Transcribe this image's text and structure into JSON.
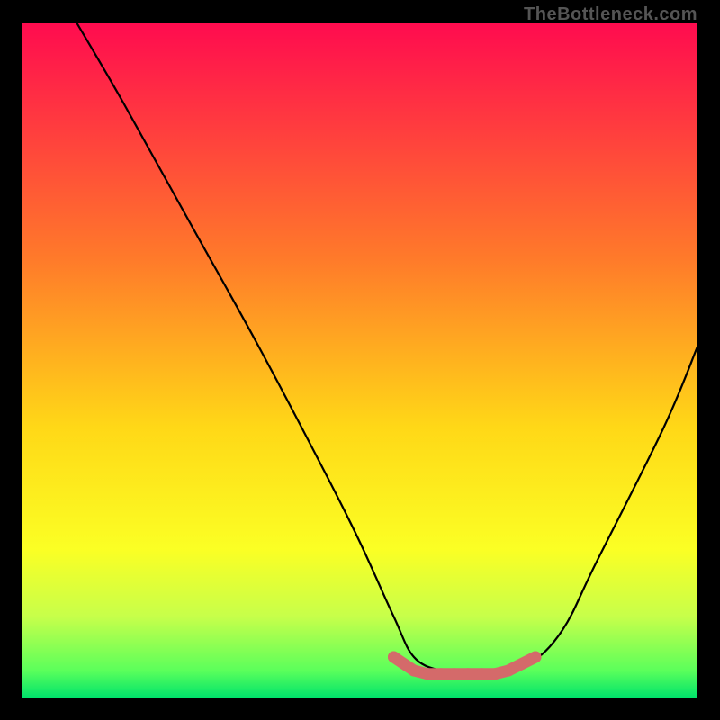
{
  "watermark": "TheBottleneck.com",
  "chart_data": {
    "type": "line",
    "title": "",
    "xlabel": "",
    "ylabel": "",
    "xlim": [
      0,
      100
    ],
    "ylim": [
      0,
      100
    ],
    "series": [
      {
        "name": "bottleneck-curve",
        "x": [
          8,
          15,
          25,
          35,
          45,
          50,
          55,
          58,
          62,
          65,
          70,
          75,
          80,
          85,
          95,
          100
        ],
        "y": [
          100,
          88,
          70,
          52,
          33,
          23,
          12,
          6,
          4,
          4,
          4,
          5,
          10,
          20,
          40,
          52
        ]
      }
    ],
    "bottom_points": {
      "name": "optimal-range-markers",
      "x": [
        55,
        58,
        60,
        62,
        64,
        66,
        68,
        70,
        72,
        74,
        76
      ],
      "y": [
        6,
        4,
        3.5,
        3.5,
        3.5,
        3.5,
        3.5,
        3.5,
        4,
        5,
        6
      ],
      "color": "#d46a6a"
    },
    "background_gradient": {
      "stops": [
        {
          "offset": 0.0,
          "color": "#ff0b4f"
        },
        {
          "offset": 0.35,
          "color": "#ff7a2a"
        },
        {
          "offset": 0.6,
          "color": "#ffd817"
        },
        {
          "offset": 0.78,
          "color": "#fbff24"
        },
        {
          "offset": 0.88,
          "color": "#c7ff4a"
        },
        {
          "offset": 0.96,
          "color": "#5bff5b"
        },
        {
          "offset": 1.0,
          "color": "#00e36b"
        }
      ]
    }
  }
}
